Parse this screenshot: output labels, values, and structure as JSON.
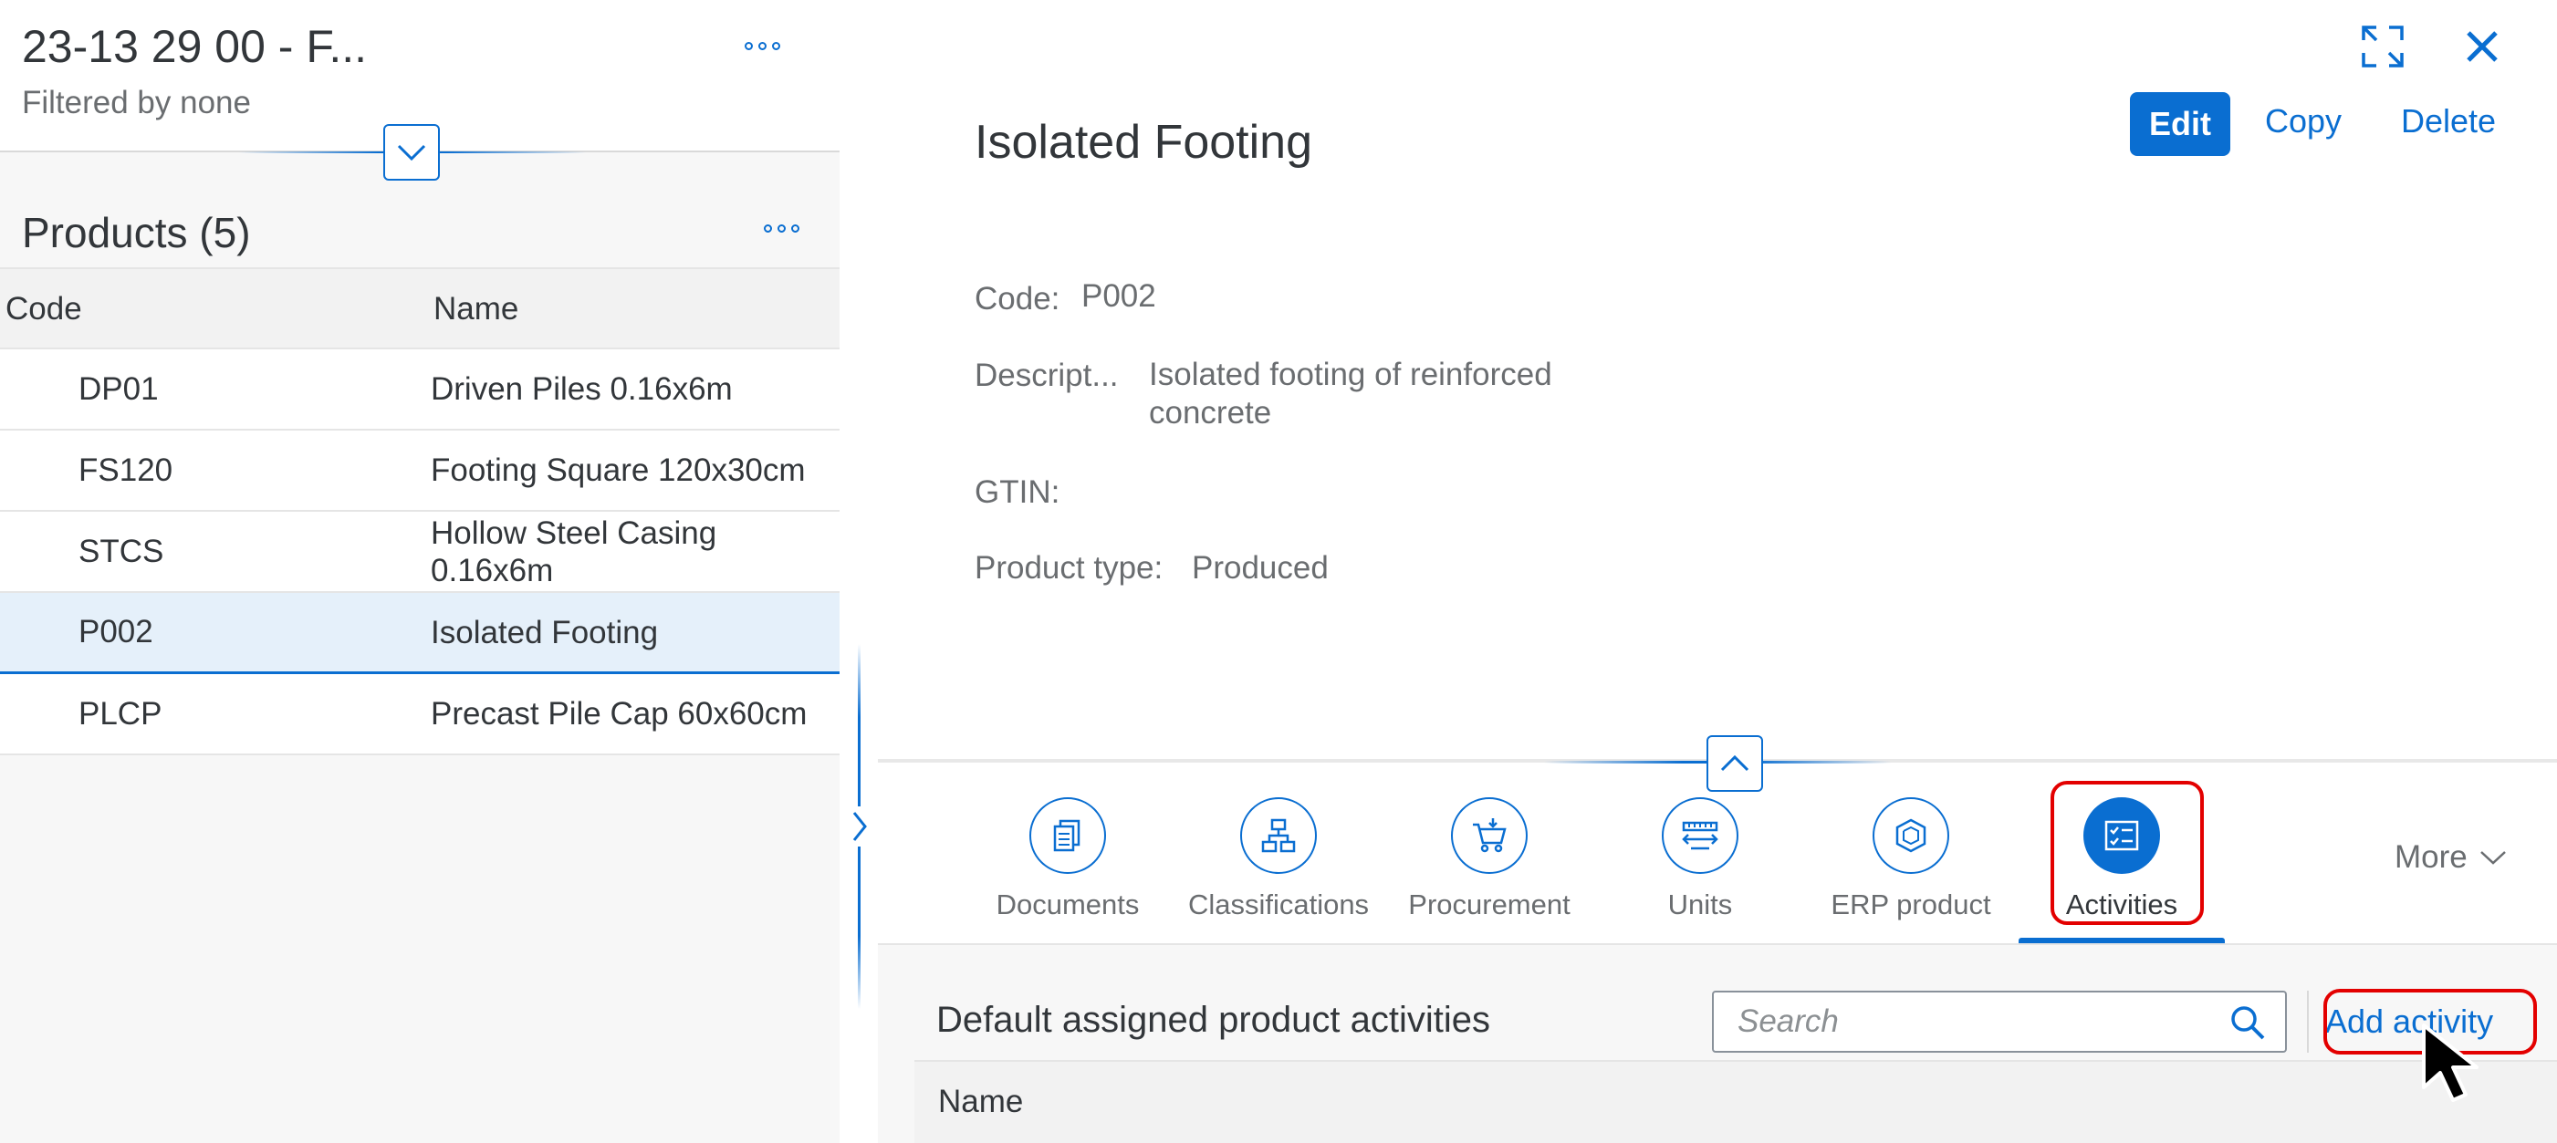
{
  "left_pane": {
    "title": "23-13 29 00 - F...",
    "subtitle": "Filtered by none",
    "products_title": "Products  (5)",
    "columns": {
      "code": "Code",
      "name": "Name"
    },
    "rows": [
      {
        "code": "DP01",
        "name": "Driven Piles 0.16x6m"
      },
      {
        "code": "FS120",
        "name": "Footing Square 120x30cm"
      },
      {
        "code": "STCS",
        "name": "Hollow Steel Casing 0.16x6m"
      },
      {
        "code": "P002",
        "name": "Isolated Footing"
      },
      {
        "code": "PLCP",
        "name": "Precast Pile Cap 60x60cm"
      }
    ]
  },
  "detail": {
    "title": "Isolated Footing",
    "actions": {
      "edit": "Edit",
      "copy": "Copy",
      "delete": "Delete"
    },
    "fields": {
      "code_label": "Code:",
      "code_value": "P002",
      "description_label": "Descript...",
      "description_value": "Isolated footing of reinforced concrete",
      "gtin_label": "GTIN:",
      "product_type_label": "Product type:",
      "product_type_value": "Produced"
    }
  },
  "tabs": [
    {
      "label": "Documents",
      "icon": "documents-icon"
    },
    {
      "label": "Classifications",
      "icon": "hierarchy-icon"
    },
    {
      "label": "Procurement",
      "icon": "cart-icon"
    },
    {
      "label": "Units",
      "icon": "measure-icon"
    },
    {
      "label": "ERP product",
      "icon": "product-box-icon"
    },
    {
      "label": "Activities",
      "icon": "checklist-icon",
      "active": true
    }
  ],
  "more_label": "More",
  "section": {
    "title": "Default assigned product activities",
    "search_placeholder": "Search",
    "add_label": "Add activity",
    "column_name": "Name"
  },
  "colors": {
    "accent": "#0a6ed1",
    "highlight": "#e30000",
    "selected_row": "#e5f0fa"
  }
}
